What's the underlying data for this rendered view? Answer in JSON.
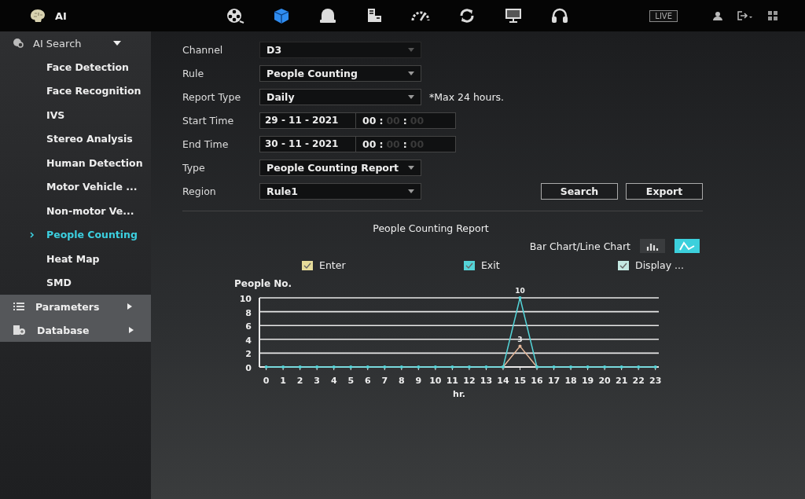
{
  "top_bar": {
    "title": "AI",
    "nav_icons": [
      {
        "kind": "film",
        "selected": false
      },
      {
        "kind": "cube",
        "selected": true
      },
      {
        "kind": "dome",
        "selected": false
      },
      {
        "kind": "register",
        "selected": false
      },
      {
        "kind": "gauge",
        "selected": false
      },
      {
        "kind": "sync",
        "selected": false
      },
      {
        "kind": "monitor",
        "selected": false
      },
      {
        "kind": "headset",
        "selected": false
      }
    ],
    "live_button": "LIVE"
  },
  "sidebar": {
    "section": {
      "label": "AI Search",
      "expanded": true
    },
    "items": [
      {
        "label": "Face Detection",
        "selected": false
      },
      {
        "label": "Face Recognition",
        "selected": false
      },
      {
        "label": "IVS",
        "selected": false
      },
      {
        "label": "Stereo Analysis",
        "selected": false
      },
      {
        "label": "Human Detection",
        "selected": false
      },
      {
        "label": "Motor Vehicle ...",
        "selected": false
      },
      {
        "label": "Non-motor Ve...",
        "selected": false
      },
      {
        "label": "People Counting",
        "selected": true
      },
      {
        "label": "Heat Map",
        "selected": false
      },
      {
        "label": "SMD",
        "selected": false
      }
    ],
    "groups": [
      {
        "label": "Parameters",
        "kind": "list",
        "expanded": false
      },
      {
        "label": "Database",
        "kind": "database",
        "expanded": false
      }
    ]
  },
  "form": {
    "fields": [
      {
        "kind": "select",
        "label": "Channel",
        "value": "D3",
        "disabled": true
      },
      {
        "kind": "select",
        "label": "Rule",
        "value": "People Counting",
        "disabled": false
      },
      {
        "kind": "select",
        "label": "Report Type",
        "value": "Daily",
        "disabled": false,
        "note": "*Max 24 hours."
      },
      {
        "kind": "datetime",
        "label": "Start Time",
        "date": "29 - 11 - 2021",
        "time": [
          {
            "text": "00",
            "dim": false
          },
          {
            "text": ":",
            "dim": false
          },
          {
            "text": "00",
            "dim": true
          },
          {
            "text": ":",
            "dim": false
          },
          {
            "text": "00",
            "dim": true
          }
        ]
      },
      {
        "kind": "datetime",
        "label": "End Time",
        "date": "30 - 11 - 2021",
        "time": [
          {
            "text": "00",
            "dim": false
          },
          {
            "text": ":",
            "dim": false
          },
          {
            "text": "00",
            "dim": true
          },
          {
            "text": ":",
            "dim": false
          },
          {
            "text": "00",
            "dim": true
          }
        ]
      },
      {
        "kind": "select",
        "label": "Type",
        "value": "People Counting Report",
        "disabled": false
      },
      {
        "kind": "select",
        "label": "Region",
        "value": "Rule1",
        "disabled": false
      }
    ],
    "buttons": [
      "Search",
      "Export"
    ]
  },
  "report": {
    "title": "People Counting Report",
    "toggle_label": "Bar Chart/Line Chart",
    "views": [
      {
        "kind": "bar",
        "selected": false
      },
      {
        "kind": "line",
        "selected": true
      }
    ],
    "legend": [
      {
        "kind": "series",
        "checked": true,
        "color": "#e6dc9a"
      },
      {
        "kind": "series",
        "checked": true,
        "color": "#54d4d8"
      },
      {
        "kind": "option",
        "label": "Display ...",
        "checked": true,
        "color": "#c4e8e2"
      }
    ],
    "chart_data": {
      "type": "line",
      "ylabel": "People No.",
      "xlabel": "hr.",
      "x": [
        0,
        1,
        2,
        3,
        4,
        5,
        6,
        7,
        8,
        9,
        10,
        11,
        12,
        13,
        14,
        15,
        16,
        17,
        18,
        19,
        20,
        21,
        22,
        23
      ],
      "series": [
        {
          "name": "Enter",
          "color": "#e6b89a",
          "values": [
            null,
            null,
            null,
            null,
            null,
            null,
            null,
            null,
            null,
            null,
            null,
            null,
            null,
            null,
            0,
            3,
            0,
            null,
            null,
            null,
            null,
            null,
            null,
            null
          ]
        },
        {
          "name": "Exit",
          "color": "#54d4d8",
          "values": [
            0,
            0,
            0,
            0,
            0,
            0,
            0,
            0,
            0,
            0,
            0,
            0,
            0,
            0,
            0,
            10,
            0,
            0,
            0,
            0,
            0,
            0,
            0,
            0
          ]
        }
      ],
      "xlim": [
        -0.4,
        23.2
      ],
      "ylim": [
        0,
        10
      ],
      "grid": true,
      "yticks": [
        0,
        2,
        4,
        6,
        8,
        10
      ],
      "xticks": [
        0,
        1,
        2,
        3,
        4,
        5,
        6,
        7,
        8,
        9,
        10,
        11,
        12,
        13,
        14,
        15,
        16,
        17,
        18,
        19,
        20,
        21,
        22,
        23
      ],
      "value_labels": [
        [
          null,
          null,
          null,
          null,
          null,
          null,
          null,
          null,
          null,
          null,
          null,
          null,
          null,
          null,
          null,
          "3",
          null,
          null,
          null,
          null,
          null,
          null,
          null,
          null
        ],
        [
          null,
          null,
          null,
          null,
          null,
          null,
          null,
          null,
          null,
          null,
          null,
          null,
          null,
          null,
          null,
          "10",
          null,
          null,
          null,
          null,
          null,
          null,
          null,
          null
        ]
      ]
    }
  }
}
